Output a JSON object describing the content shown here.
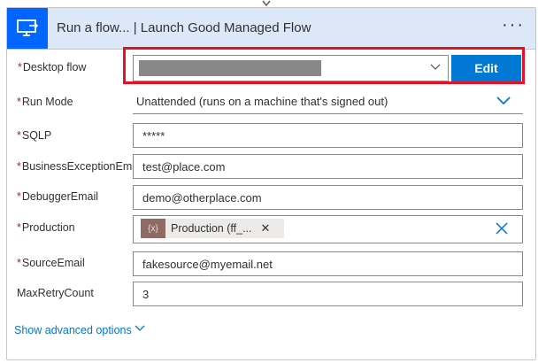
{
  "header": {
    "title": "Run a flow... | Launch Good Managed Flow",
    "more_label": "···"
  },
  "desktop_flow": {
    "label": "Desktop flow",
    "edit_label": "Edit"
  },
  "run_mode": {
    "label": "Run Mode",
    "value": "Unattended (runs on a machine that's signed out)"
  },
  "fields": [
    {
      "label": "SQLP",
      "value": "*****"
    },
    {
      "label": "BusinessExceptionEmail",
      "value": "test@place.com"
    },
    {
      "label": "DebuggerEmail",
      "value": "demo@otherplace.com"
    },
    {
      "label": "Production",
      "token_text": "Production (ff_...",
      "token_icon": "{x}"
    },
    {
      "label": "SourceEmail",
      "value": "fakesource@myemail.net"
    },
    {
      "label": "MaxRetryCount",
      "value": "3"
    }
  ],
  "required_marker": "*",
  "advanced": {
    "label": "Show advanced options"
  },
  "colors": {
    "accent": "#0078d4",
    "highlight": "#e81123",
    "header_bg": "#dce8f8",
    "required": "#a4262c"
  },
  "icons": [
    "desktop-flow-icon",
    "more-icon",
    "chevron-down-icon",
    "close-icon",
    "variable-icon"
  ]
}
